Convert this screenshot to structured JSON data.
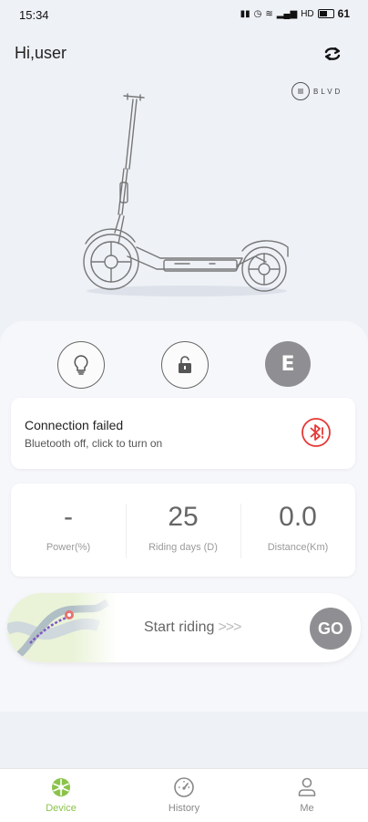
{
  "status_bar": {
    "time": "15:34",
    "network": "HD",
    "battery": "61"
  },
  "header": {
    "greeting": "Hi,user",
    "brand": "BLVD"
  },
  "controls": {
    "headlight": "lightbulb-icon",
    "lock": "unlock-icon",
    "mode": "E"
  },
  "connection": {
    "title": "Connection failed",
    "subtitle": "Bluetooth off, click to turn on",
    "accent": "#e53935"
  },
  "stats": [
    {
      "value": "-",
      "label": "Power(%)"
    },
    {
      "value": "25",
      "label": "Riding days (D)"
    },
    {
      "value": "0.0",
      "label": "Distance(Km)"
    }
  ],
  "ride": {
    "label": "Start riding",
    "arrows": ">>>",
    "go": "GO"
  },
  "nav": {
    "items": [
      {
        "label": "Device",
        "active": true
      },
      {
        "label": "History",
        "active": false
      },
      {
        "label": "Me",
        "active": false
      }
    ],
    "active_color": "#8bc34a"
  }
}
